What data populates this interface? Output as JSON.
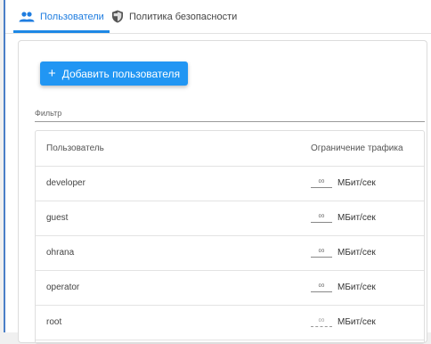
{
  "tabs": [
    {
      "label": "Пользователи",
      "icon": "users-icon",
      "active": true
    },
    {
      "label": "Политика безопасности",
      "icon": "shield-icon",
      "active": false
    }
  ],
  "add_button": {
    "label": "Добавить пользователя",
    "icon": "plus"
  },
  "filter": {
    "placeholder": "Фильтр",
    "value": ""
  },
  "table": {
    "headers": {
      "user": "Пользователь",
      "limit": "Ограничение трафика"
    },
    "rows": [
      {
        "user": "developer",
        "limit": "∞",
        "unit": "МБит/сек"
      },
      {
        "user": "guest",
        "limit": "∞",
        "unit": "МБит/сек"
      },
      {
        "user": "ohrana",
        "limit": "∞",
        "unit": "МБит/сек"
      },
      {
        "user": "operator",
        "limit": "∞",
        "unit": "МБит/сек"
      },
      {
        "user": "root",
        "limit": "∞",
        "unit": "МБит/сек",
        "disabled": true
      }
    ]
  },
  "colors": {
    "accent": "#2196f3",
    "tab_active": "#1f7de0"
  }
}
